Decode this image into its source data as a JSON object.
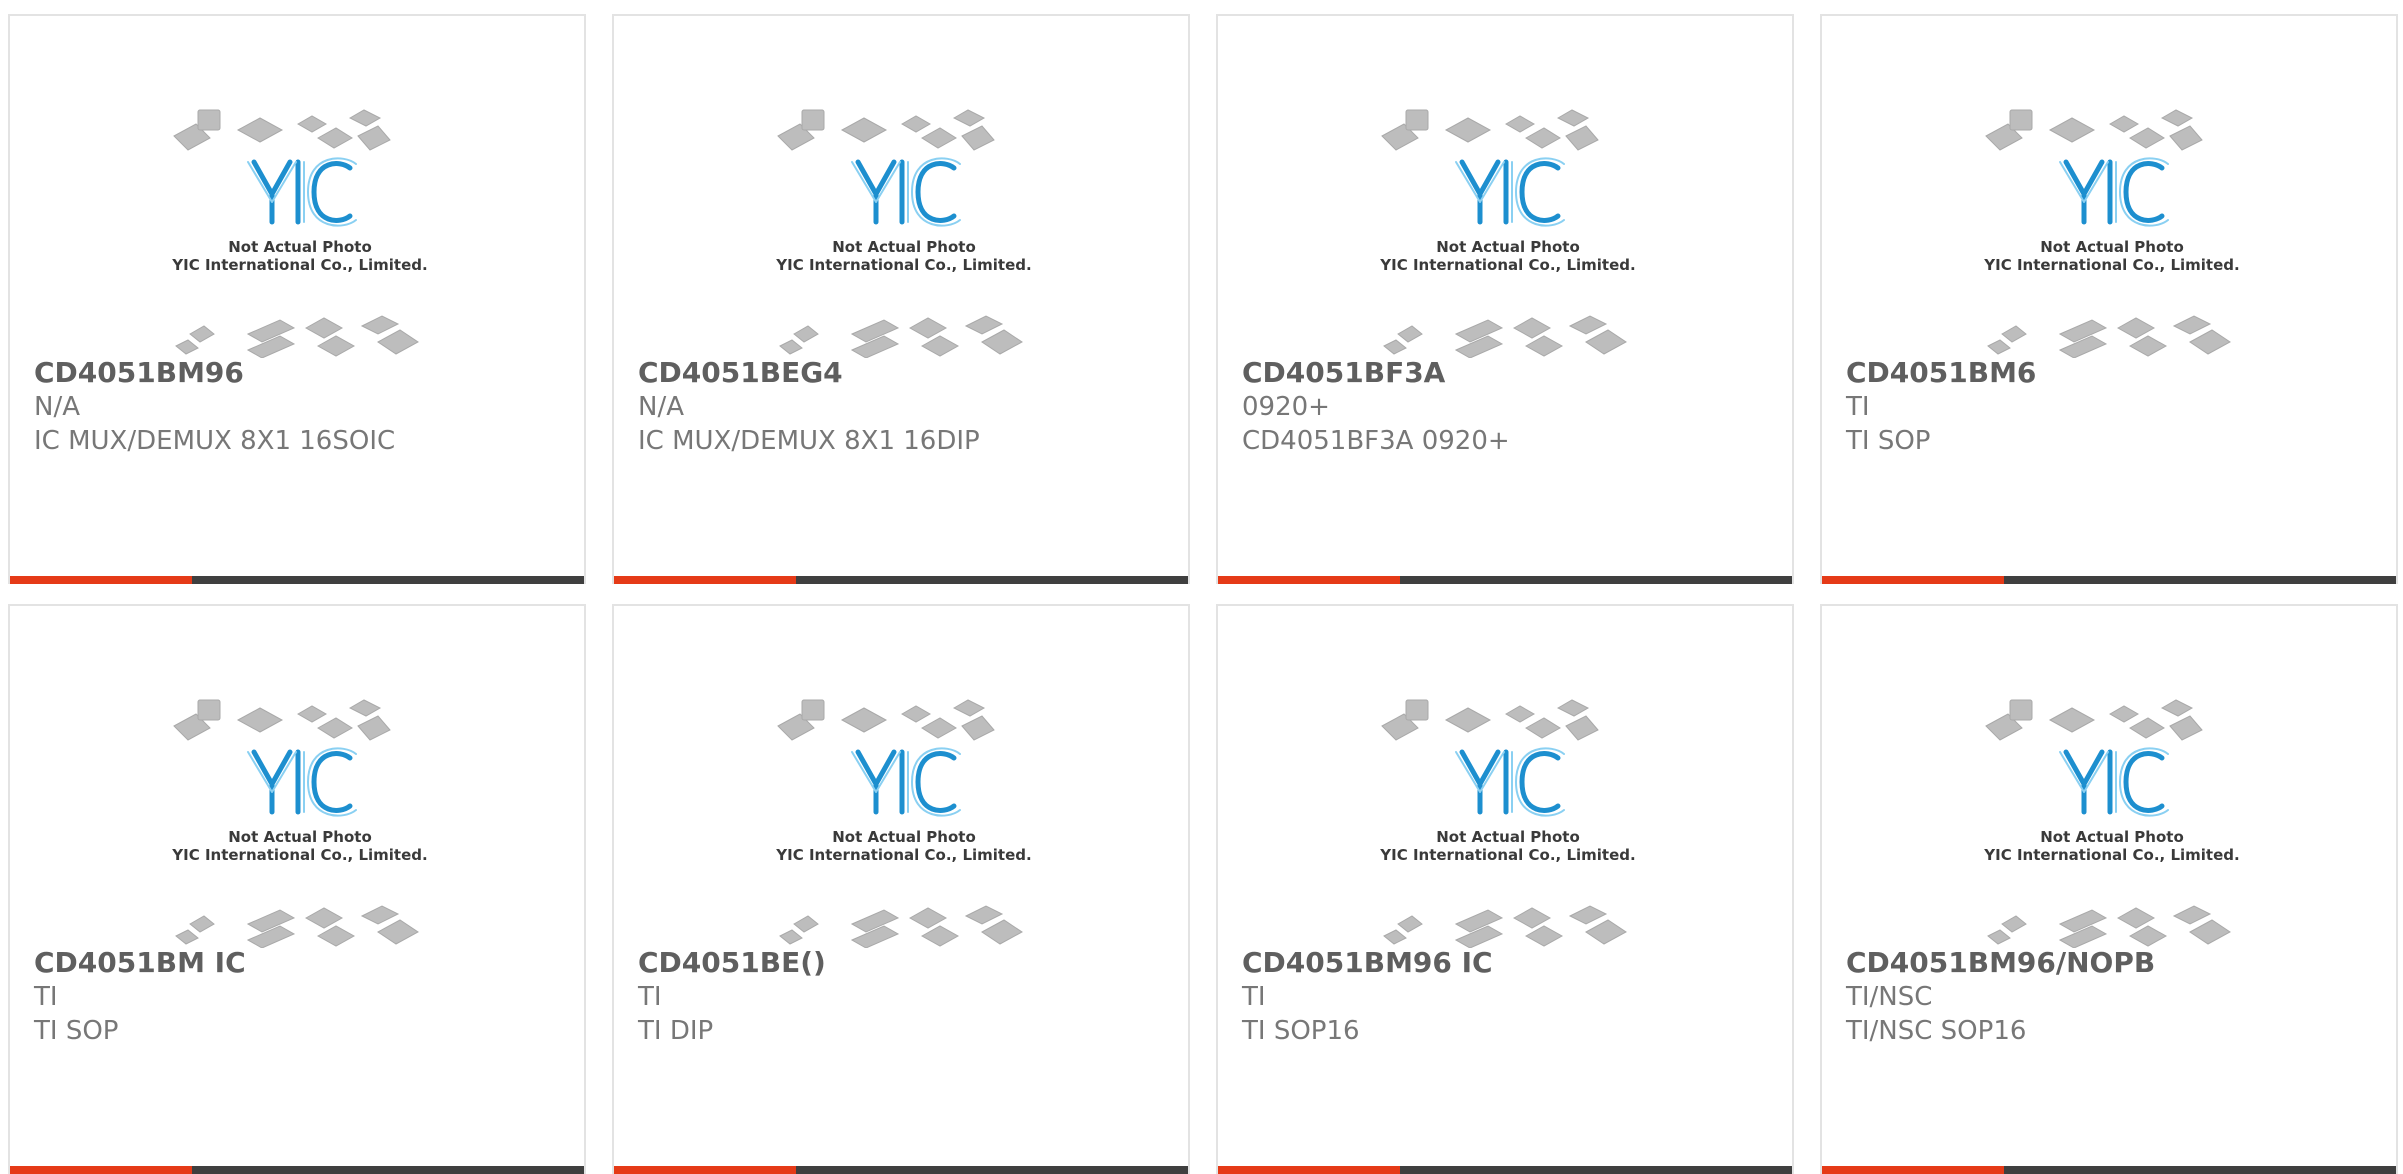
{
  "products": [
    {
      "part": "CD4051BM96",
      "maker": "N/A",
      "desc": "IC MUX/DEMUX 8X1 16SOIC"
    },
    {
      "part": "CD4051BEG4",
      "maker": "N/A",
      "desc": "IC MUX/DEMUX 8X1 16DIP"
    },
    {
      "part": "CD4051BF3A",
      "maker": "0920+",
      "desc": "CD4051BF3A 0920+"
    },
    {
      "part": "CD4051BM6",
      "maker": "TI",
      "desc": "TI SOP"
    },
    {
      "part": "CD4051BM IC",
      "maker": "TI",
      "desc": "TI SOP"
    },
    {
      "part": "CD4051BE()",
      "maker": "TI",
      "desc": "TI DIP"
    },
    {
      "part": "CD4051BM96 IC",
      "maker": "TI",
      "desc": "TI SOP16"
    },
    {
      "part": "CD4051BM96/NOPB",
      "maker": "TI/NSC",
      "desc": "TI/NSC SOP16"
    }
  ],
  "placeholder": {
    "logo_text": "YIC",
    "line1": "Not Actual Photo",
    "line2": "YIC International Co., Limited."
  },
  "colors": {
    "accent": "#e53a17",
    "bar": "#3f3f3f",
    "logo": "#1d8fcf",
    "border": "#e3e3e3"
  }
}
